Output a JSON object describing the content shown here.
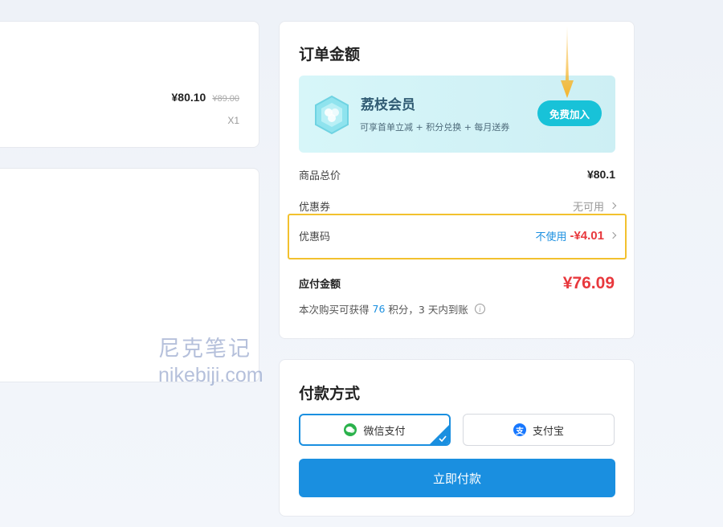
{
  "product": {
    "price": "¥80.10",
    "original_price": "¥89.00",
    "quantity": "X1"
  },
  "watermark": {
    "cn": "尼克笔记",
    "en": "nikebiji.com"
  },
  "summary": {
    "title": "订单金额",
    "member": {
      "name": "荔枝会员",
      "desc": "可享首单立减 + 积分兑换 + 每月送券",
      "join_label": "免费加入"
    },
    "rows": {
      "total_label": "商品总价",
      "total_value": "¥80.1",
      "coupon_label": "优惠券",
      "coupon_value": "无可用",
      "promo_label": "优惠码",
      "promo_unused": "不使用",
      "promo_discount": "-¥4.01"
    },
    "payable_label": "应付金额",
    "payable_amount": "¥76.09",
    "points": {
      "prefix": "本次购买可获得",
      "value": "76",
      "suffix": "积分，3 天内到账"
    }
  },
  "payment": {
    "title": "付款方式",
    "wechat_label": "微信支付",
    "alipay_label": "支付宝",
    "pay_now_label": "立即付款"
  },
  "colors": {
    "accent": "#1a8fe0",
    "price_red": "#e8383d",
    "highlight_yellow": "#f2c12e",
    "member_cyan": "#18c2d8"
  }
}
